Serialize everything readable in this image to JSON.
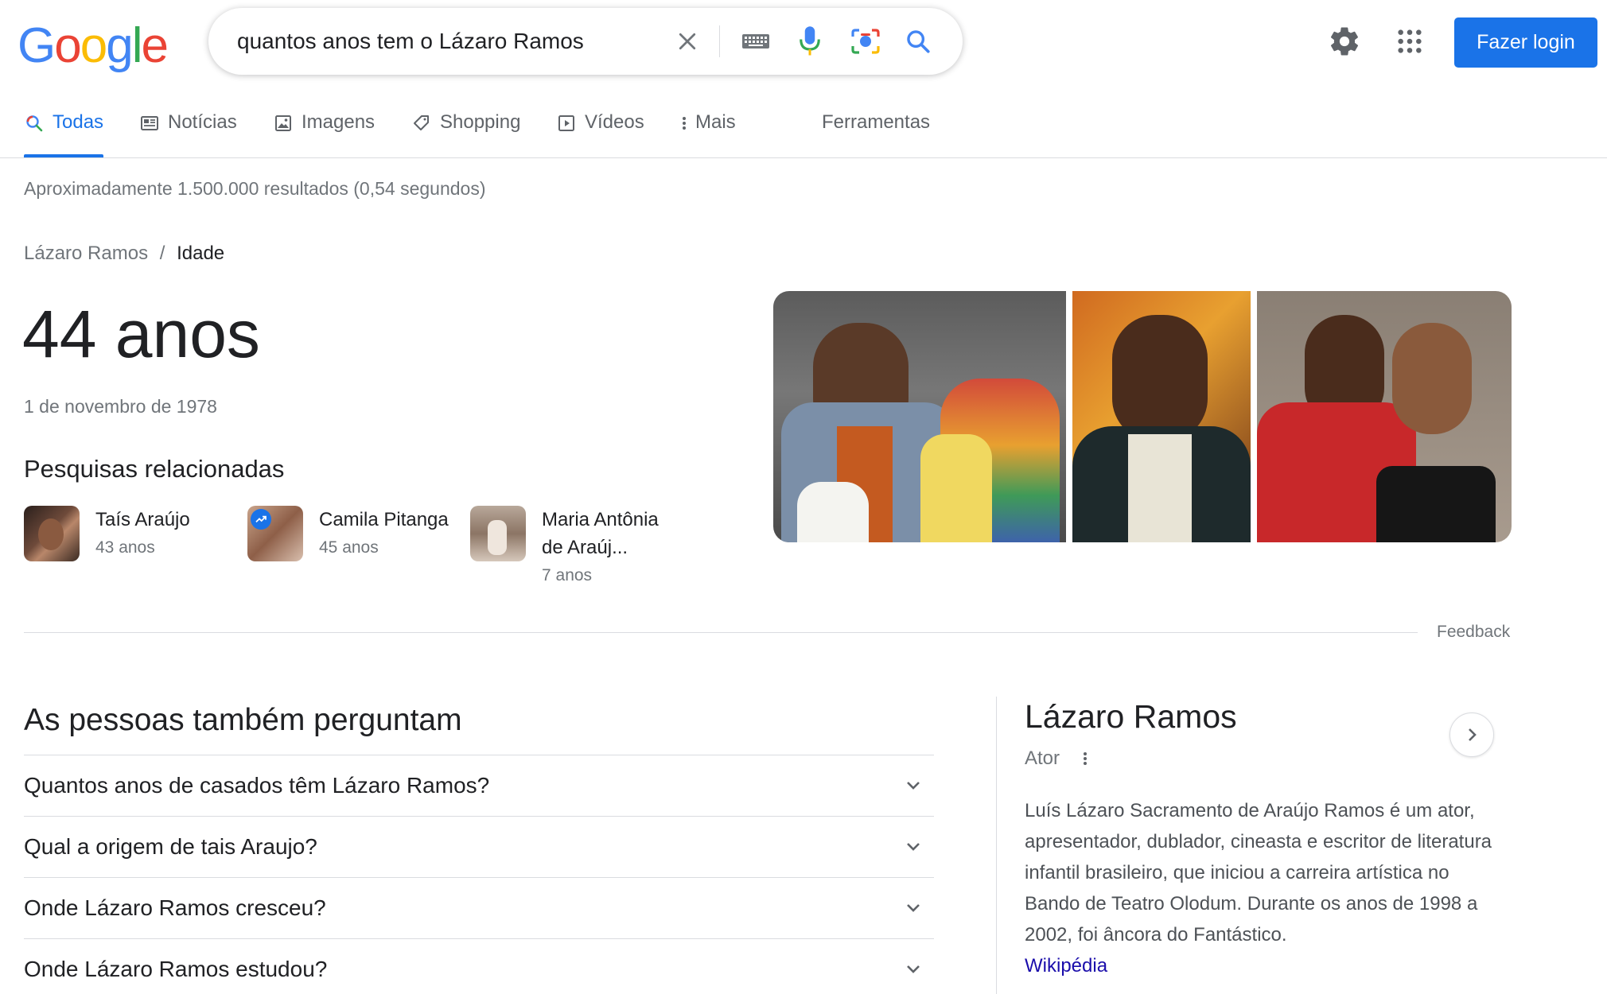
{
  "header": {
    "logo_letters": [
      {
        "ch": "G",
        "color": "#4285F4"
      },
      {
        "ch": "o",
        "color": "#EA4335"
      },
      {
        "ch": "o",
        "color": "#FBBC05"
      },
      {
        "ch": "g",
        "color": "#4285F4"
      },
      {
        "ch": "l",
        "color": "#34A853"
      },
      {
        "ch": "e",
        "color": "#EA4335"
      }
    ],
    "search_query": "quantos anos tem o Lázaro Ramos",
    "login_label": "Fazer login",
    "icons": [
      "clear-icon",
      "keyboard-icon",
      "microphone-icon",
      "camera-lens-icon",
      "search-icon",
      "settings-gear-icon",
      "apps-grid-icon"
    ]
  },
  "tabs": [
    {
      "label": "Todas",
      "icon": "search-icon",
      "active": true
    },
    {
      "label": "Notícias",
      "icon": "news-icon",
      "active": false
    },
    {
      "label": "Imagens",
      "icon": "image-icon",
      "active": false
    },
    {
      "label": "Shopping",
      "icon": "tag-icon",
      "active": false
    },
    {
      "label": "Vídeos",
      "icon": "play-icon",
      "active": false
    },
    {
      "label": "Mais",
      "icon": "more-vertical-icon",
      "active": false
    },
    {
      "label": "Ferramentas",
      "icon": "",
      "active": false
    }
  ],
  "results_count": "Aproximadamente 1.500.000 resultados (0,54 segundos)",
  "answer": {
    "breadcrumb_entity": "Lázaro Ramos",
    "breadcrumb_sep": "/",
    "breadcrumb_attr": "Idade",
    "age": "44 anos",
    "dob": "1 de novembro de 1978",
    "related_title": "Pesquisas relacionadas",
    "related": [
      {
        "name": "Taís Araújo",
        "age": "43 anos"
      },
      {
        "name": "Camila Pitanga",
        "age": "45 anos"
      },
      {
        "name": "Maria Antônia de Araúj...",
        "age": "7 anos"
      }
    ],
    "feedback": "Feedback"
  },
  "paa": {
    "title": "As pessoas também perguntam",
    "questions": [
      "Quantos anos de casados têm Lázaro Ramos?",
      "Qual a origem de tais Araujo?",
      "Onde Lázaro Ramos cresceu?",
      "Onde Lázaro Ramos estudou?"
    ]
  },
  "knowledge_panel": {
    "title": "Lázaro Ramos",
    "subtitle": "Ator",
    "description": "Luís Lázaro Sacramento de Araújo Ramos é um ator, apresentador, dublador, cineasta e escritor de literatura infantil brasileiro, que iniciou a carreira artística no Bando de Teatro Olodum. Durante os anos de 1998 a 2002, foi âncora do Fantástico.",
    "source": "Wikipédia"
  },
  "colors": {
    "accent": "#1a73e8",
    "link": "#1a0dab",
    "muted": "#70757a"
  }
}
